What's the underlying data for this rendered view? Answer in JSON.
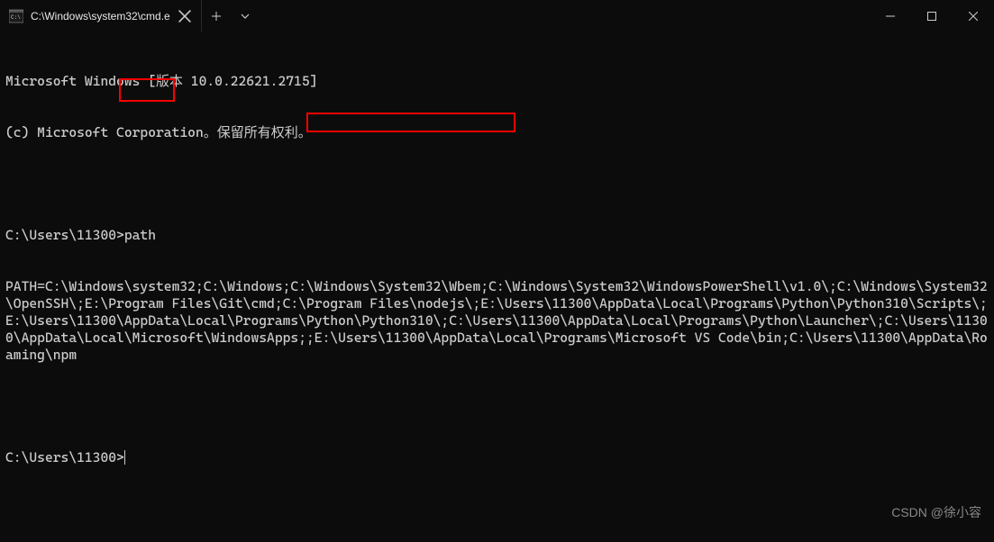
{
  "tab": {
    "title": "C:\\Windows\\system32\\cmd.e"
  },
  "terminal": {
    "header1": "Microsoft Windows [版本 10.0.22621.2715]",
    "header2": "(c) Microsoft Corporation。保留所有权利。",
    "prompt1": "C:\\Users\\11300>",
    "command1": "path",
    "path_output": "PATH=C:\\Windows\\system32;C:\\Windows;C:\\Windows\\System32\\Wbem;C:\\Windows\\System32\\WindowsPowerShell\\v1.0\\;C:\\Windows\\System32\\OpenSSH\\;E:\\Program Files\\Git\\cmd;C:\\Program Files\\nodejs\\;E:\\Users\\11300\\AppData\\Local\\Programs\\Python\\Python310\\Scripts\\;E:\\Users\\11300\\AppData\\Local\\Programs\\Python\\Python310\\;C:\\Users\\11300\\AppData\\Local\\Programs\\Python\\Launcher\\;C:\\Users\\11300\\AppData\\Local\\Microsoft\\WindowsApps;;E:\\Users\\11300\\AppData\\Local\\Programs\\Microsoft VS Code\\bin;C:\\Users\\11300\\AppData\\Roaming\\npm",
    "prompt2": "C:\\Users\\11300>"
  },
  "highlighted": {
    "command": "path",
    "path_segment": ";C:\\Program Files\\nodejs\\"
  },
  "watermark": "CSDN @徐小容"
}
